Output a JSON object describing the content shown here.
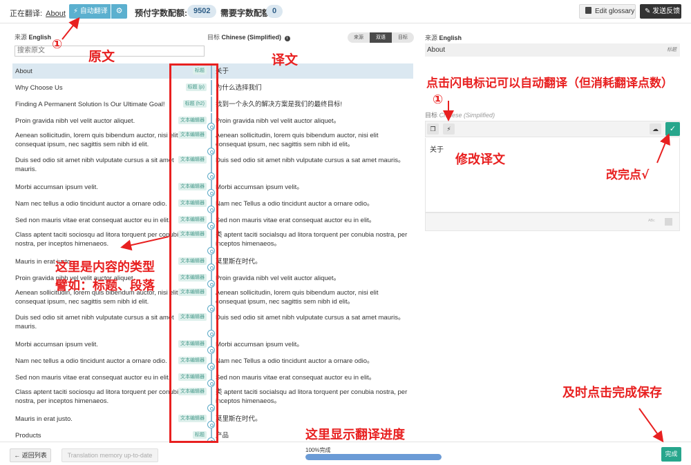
{
  "topbar": {
    "now_translating_label": "正在翻译:",
    "now_translating_page": "About",
    "auto_translate_label": "自动翻译",
    "prepaid_quota_label": "预付字数配额:",
    "prepaid_quota_value": "9502",
    "required_quota_label": "需要字数配额",
    "required_quota_value": "0",
    "edit_glossary_label": "Edit glossary",
    "feedback_label": "发送反馈"
  },
  "left_panel": {
    "source_prefix": "来源",
    "source_lang": "English",
    "target_prefix": "目标",
    "target_lang": "Chinese (Simplified)",
    "view_modes": [
      "来源",
      "双语",
      "目标"
    ],
    "active_view": "双语",
    "search_placeholder": "搜索原文"
  },
  "rows": [
    {
      "src": "About",
      "tag": "标题",
      "tgt": "关于",
      "selected": true
    },
    {
      "src": "Why Choose Us",
      "tag": "标题 (p)",
      "tgt": "为什么选择我们"
    },
    {
      "src": "Finding A Permanent Solution Is Our Ultimate Goal!",
      "tag": "标题 (h2)",
      "tgt": "找到一个永久的解决方案是我们的最终目标!"
    },
    {
      "src": "Proin gravida nibh vel velit auctor aliquet.",
      "tag": "文本编辑器",
      "tgt": "Proin gravida nibh vel velit auctor aliquet。"
    },
    {
      "src": "Aenean sollicitudin, lorem quis bibendum auctor, nisi elit consequat ipsum, nec sagittis sem nibh id elit.",
      "tag": "文本编辑器",
      "tgt": "Aenean sollicitudin, lorem quis bibendum auctor, nisi elit consequat ipsum, nec sagittis sem nibh id elit。"
    },
    {
      "src": "Duis sed odio sit amet nibh vulputate cursus a sit amet mauris.",
      "tag": "文本编辑器",
      "tgt": "Duis sed odio sit amet nibh vulputate cursus a sat amet mauris。"
    },
    {
      "src": "Morbi accumsan ipsum velit.",
      "tag": "文本编辑器",
      "tgt": "Morbi accumsan ipsum velit。"
    },
    {
      "src": "Nam nec tellus a odio tincidunt auctor a ornare odio.",
      "tag": "文本编辑器",
      "tgt": "Nam nec Tellus a odio tincidunt auctor a ornare odio。"
    },
    {
      "src": "Sed non mauris vitae erat consequat auctor eu in elit.",
      "tag": "文本编辑器",
      "tgt": "Sed non mauris vitae erat consequat auctor eu in elit。"
    },
    {
      "src": "Class aptent taciti sociosqu ad litora torquent per conubia nostra, per inceptos himenaeos.",
      "tag": "文本编辑器",
      "tgt": "类 aptent taciti socialsqu ad litora torquent per conubia nostra, per inceptos himenaeos。"
    },
    {
      "src": "Mauris in erat justo.",
      "tag": "文本编辑器",
      "tgt": "莫里斯在时代。"
    },
    {
      "src": "Proin gravida nibh vel velit auctor aliquet.",
      "tag": "文本编辑器",
      "tgt": "Proin gravida nibh vel velit auctor aliquet。"
    },
    {
      "src": "Aenean sollicitudin, lorem quis bibendum auctor, nisi elit consequat ipsum, nec sagittis sem nibh id elit.",
      "tag": "文本编辑器",
      "tgt": "Aenean sollicitudin, lorem quis bibendum auctor, nisi elit consequat ipsum, nec sagittis sem nibh id elit。"
    },
    {
      "src": "Duis sed odio sit amet nibh vulputate cursus a sit amet mauris.",
      "tag": "文本编辑器",
      "tgt": "Duis sed odio sit amet nibh vulputate cursus a sat amet mauris。"
    },
    {
      "src": "Morbi accumsan ipsum velit.",
      "tag": "文本编辑器",
      "tgt": "Morbi accumsan ipsum velit。"
    },
    {
      "src": "Nam nec tellus a odio tincidunt auctor a ornare odio.",
      "tag": "文本编辑器",
      "tgt": "Nam nec Tellus a odio tincidunt auctor a ornare odio。"
    },
    {
      "src": "Sed non mauris vitae erat consequat auctor eu in elit.",
      "tag": "文本编辑器",
      "tgt": "Sed non mauris vitae erat consequat auctor eu in elit。"
    },
    {
      "src": "Class aptent taciti sociosqu ad litora torquent per conubia nostra, per inceptos himenaeos.",
      "tag": "文本编辑器",
      "tgt": "类 aptent taciti socialsqu ad litora torquent per conubia nostra, per inceptos himenaeos。"
    },
    {
      "src": "Mauris in erat justo.",
      "tag": "文本编辑器",
      "tgt": "莫里斯在时代。"
    },
    {
      "src": "Products",
      "tag": "标题",
      "tgt": "产品"
    }
  ],
  "right_panel": {
    "source_prefix": "来源",
    "source_lang": "English",
    "source_text": "About",
    "source_tag": "标题",
    "target_prefix": "目标",
    "target_lang": "Chinese (Simplified)",
    "target_text": "关于"
  },
  "bottombar": {
    "back_label": "← 返回列表",
    "tm_label": "Translation memory up-to-date",
    "progress_label": "100%完成",
    "progress_fraction": 1.0,
    "done_label": "完成"
  },
  "annotations": {
    "circle_one_a": "①",
    "circle_one_b": "①",
    "source_text": "原文",
    "translation": "译文",
    "lightning_hint": "点击闪电标记可以自动翻译（但消耗翻译点数）",
    "edit_translation": "修改译文",
    "done_check": "改完点√",
    "content_type_1": "这里是内容的类型",
    "content_type_2": "譬如：标题、段落",
    "progress_hint": "这里显示翻译进度",
    "save_hint": "及时点击完成保存"
  },
  "colors": {
    "accent_blue": "#5bb0cf",
    "done_green": "#27a68c",
    "annotation_red": "#e82020",
    "progress_blue": "#6b9bd6"
  }
}
